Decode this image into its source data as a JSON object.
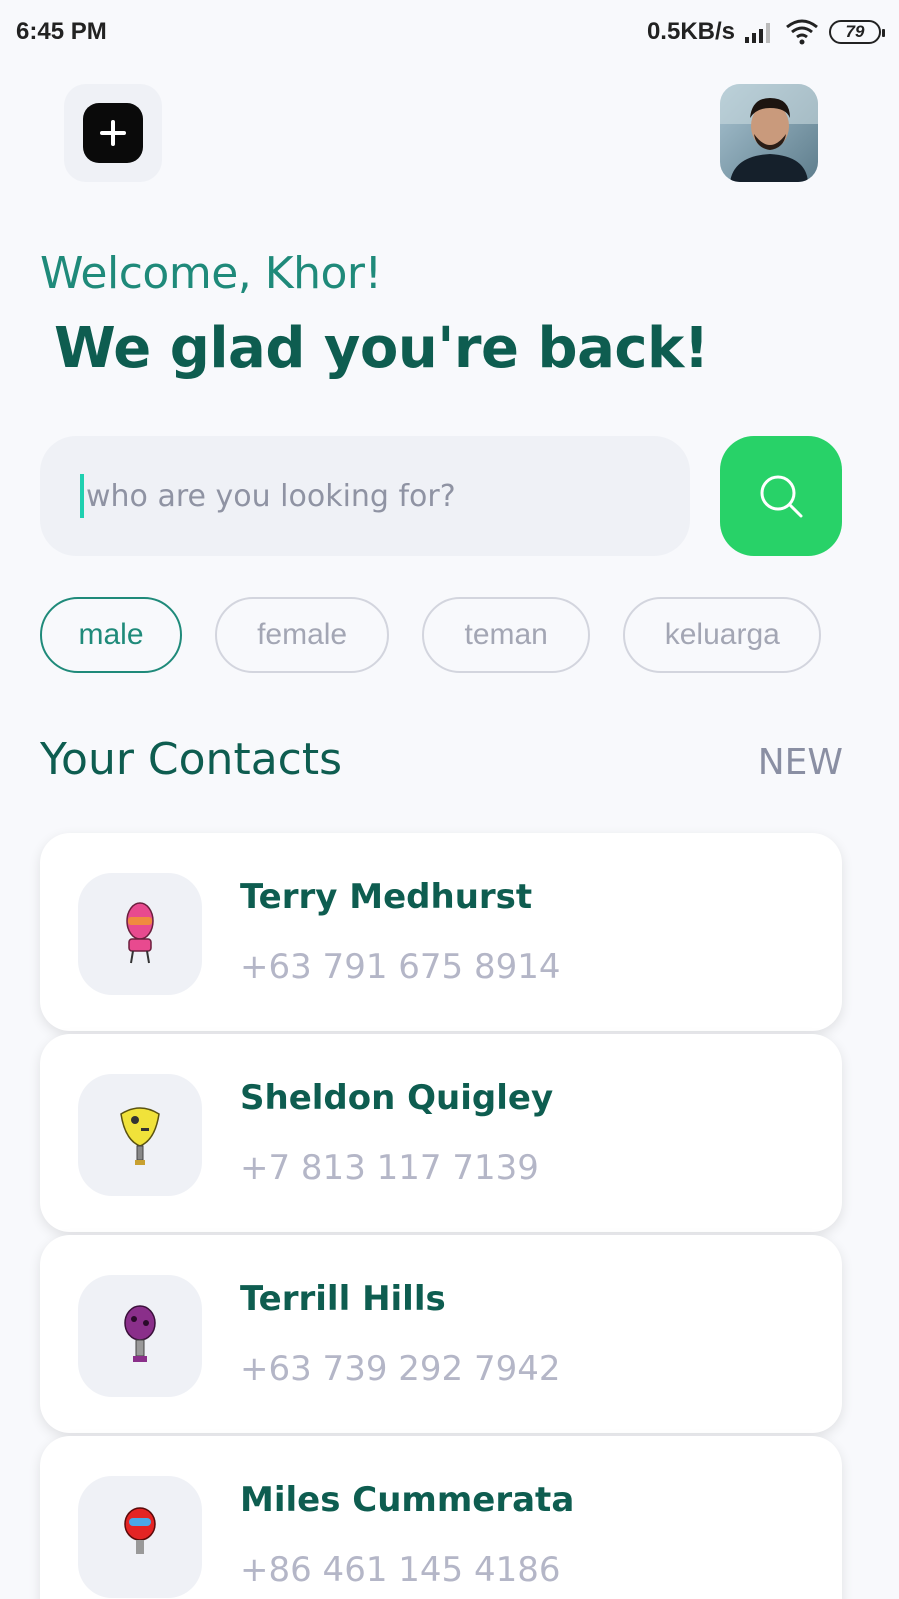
{
  "status_bar": {
    "time": "6:45 PM",
    "net_speed": "0.5KB/s",
    "battery": "79"
  },
  "header": {
    "add_icon": "plus-icon",
    "avatar_icon": "profile-photo"
  },
  "greeting": {
    "welcome": "Welcome, Khor!",
    "headline": "We glad you're back!"
  },
  "search": {
    "placeholder": "who are you looking for?",
    "value": "",
    "button_icon": "search-icon",
    "button_color": "#28d268"
  },
  "filters": [
    {
      "label": "male",
      "active": true
    },
    {
      "label": "female",
      "active": false
    },
    {
      "label": "teman",
      "active": false
    },
    {
      "label": "keluarga",
      "active": false
    }
  ],
  "contacts_section": {
    "title": "Your Contacts",
    "action": "NEW"
  },
  "contacts": [
    {
      "name": "Terry Medhurst",
      "phone": "+63 791 675 8914",
      "avatar_color": "#e84a8f"
    },
    {
      "name": "Sheldon Quigley",
      "phone": "+7 813 117 7139",
      "avatar_color": "#f0e23a"
    },
    {
      "name": "Terrill Hills",
      "phone": "+63 739 292 7942",
      "avatar_color": "#8a2f8a"
    },
    {
      "name": "Miles Cummerata",
      "phone": "+86 461 145 4186",
      "avatar_color": "#e42424"
    }
  ],
  "colors": {
    "primary_dark": "#0e5d50",
    "primary": "#1f8a7a",
    "accent_green": "#28d268",
    "background": "#f8f9fc"
  }
}
